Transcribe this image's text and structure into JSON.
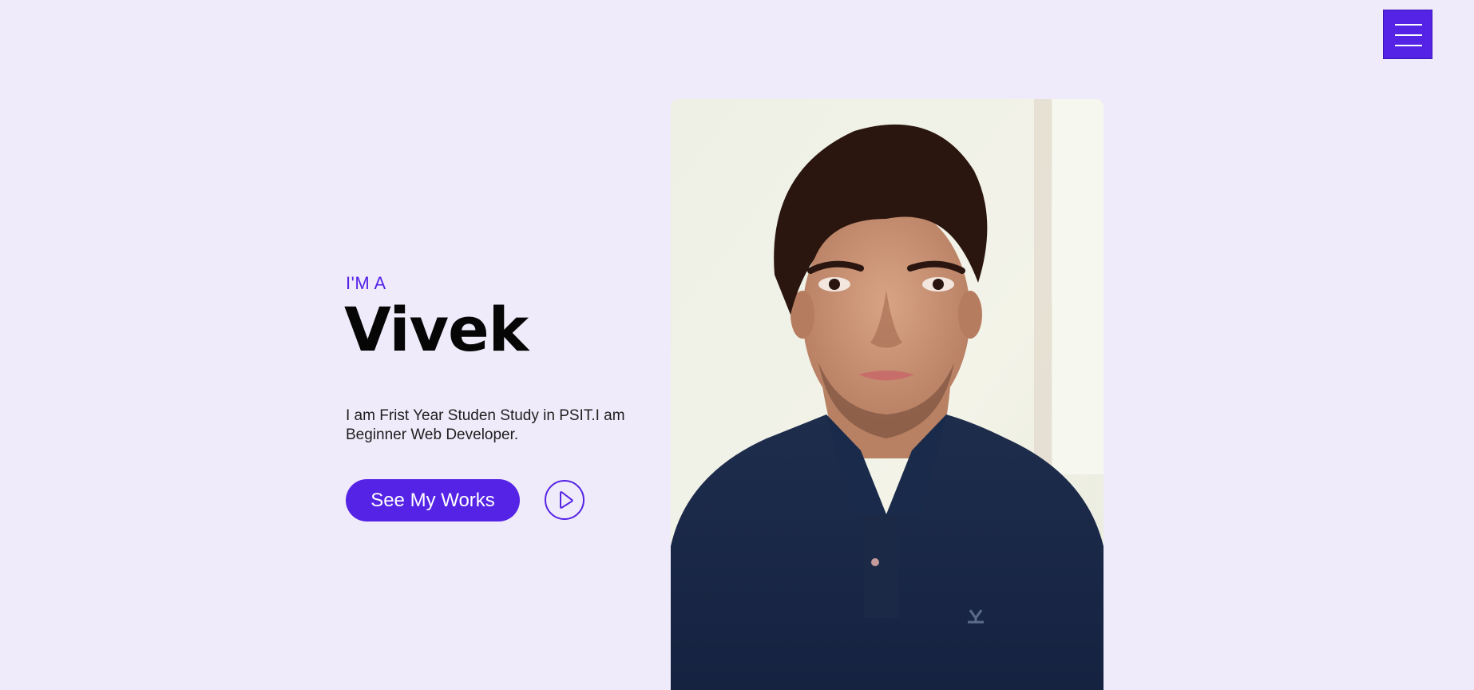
{
  "header": {
    "menu_icon": "hamburger-menu-icon"
  },
  "hero": {
    "eyebrow": "I'M A",
    "name": "Vivek",
    "bio": "I am Frist Year Studen Study in PSIT.I am Beginner Web Developer.",
    "cta_label": "See My Works",
    "play_icon": "play-icon"
  },
  "portrait": {
    "alt": "Portrait photo of Vivek"
  },
  "colors": {
    "background": "#efebfa",
    "accent": "#5523e6",
    "heading": "#060606",
    "body_text": "#1f1f1f"
  }
}
